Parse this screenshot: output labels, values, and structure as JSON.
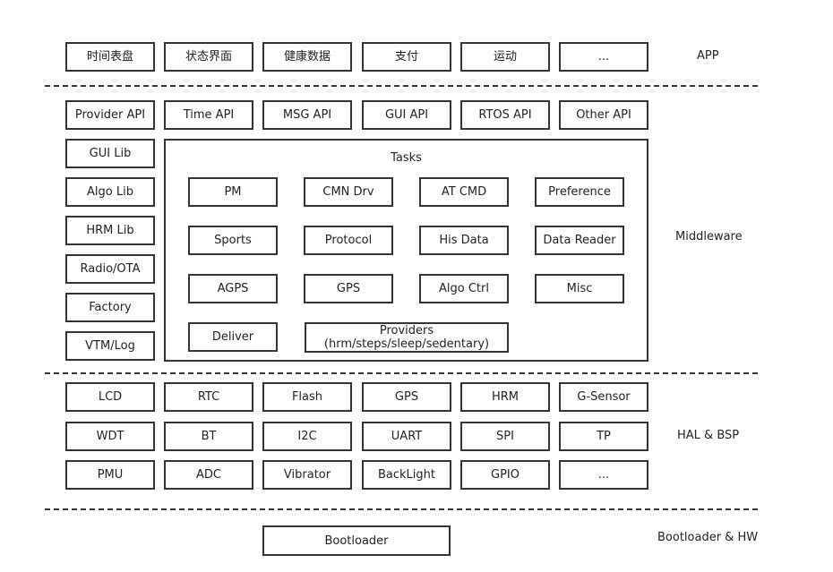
{
  "app": {
    "label": "APP",
    "items": [
      "时间表盘",
      "状态界面",
      "健康数据",
      "支付",
      "运动",
      "..."
    ]
  },
  "middleware": {
    "label": "Middleware",
    "apis": [
      "Provider API",
      "Time API",
      "MSG API",
      "GUI API",
      "RTOS API",
      "Other API"
    ],
    "libs": [
      "GUI Lib",
      "Algo Lib",
      "HRM Lib",
      "Radio/OTA",
      "Factory",
      "VTM/Log"
    ],
    "tasks": {
      "title": "Tasks",
      "items": [
        "PM",
        "CMN Drv",
        "AT CMD",
        "Preference",
        "Sports",
        "Protocol",
        "His Data",
        "Data Reader",
        "AGPS",
        "GPS",
        "Algo Ctrl",
        "Misc",
        "Deliver"
      ],
      "providers": {
        "line1": "Providers",
        "line2": "(hrm/steps/sleep/sedentary)"
      }
    }
  },
  "hal": {
    "label": "HAL & BSP",
    "items": [
      "LCD",
      "RTC",
      "Flash",
      "GPS",
      "HRM",
      "G-Sensor",
      "WDT",
      "BT",
      "I2C",
      "UART",
      "SPI",
      "TP",
      "PMU",
      "ADC",
      "Vibrator",
      "BackLight",
      "GPIO",
      "..."
    ]
  },
  "boot": {
    "label": "Bootloader & HW",
    "item": "Bootloader"
  }
}
